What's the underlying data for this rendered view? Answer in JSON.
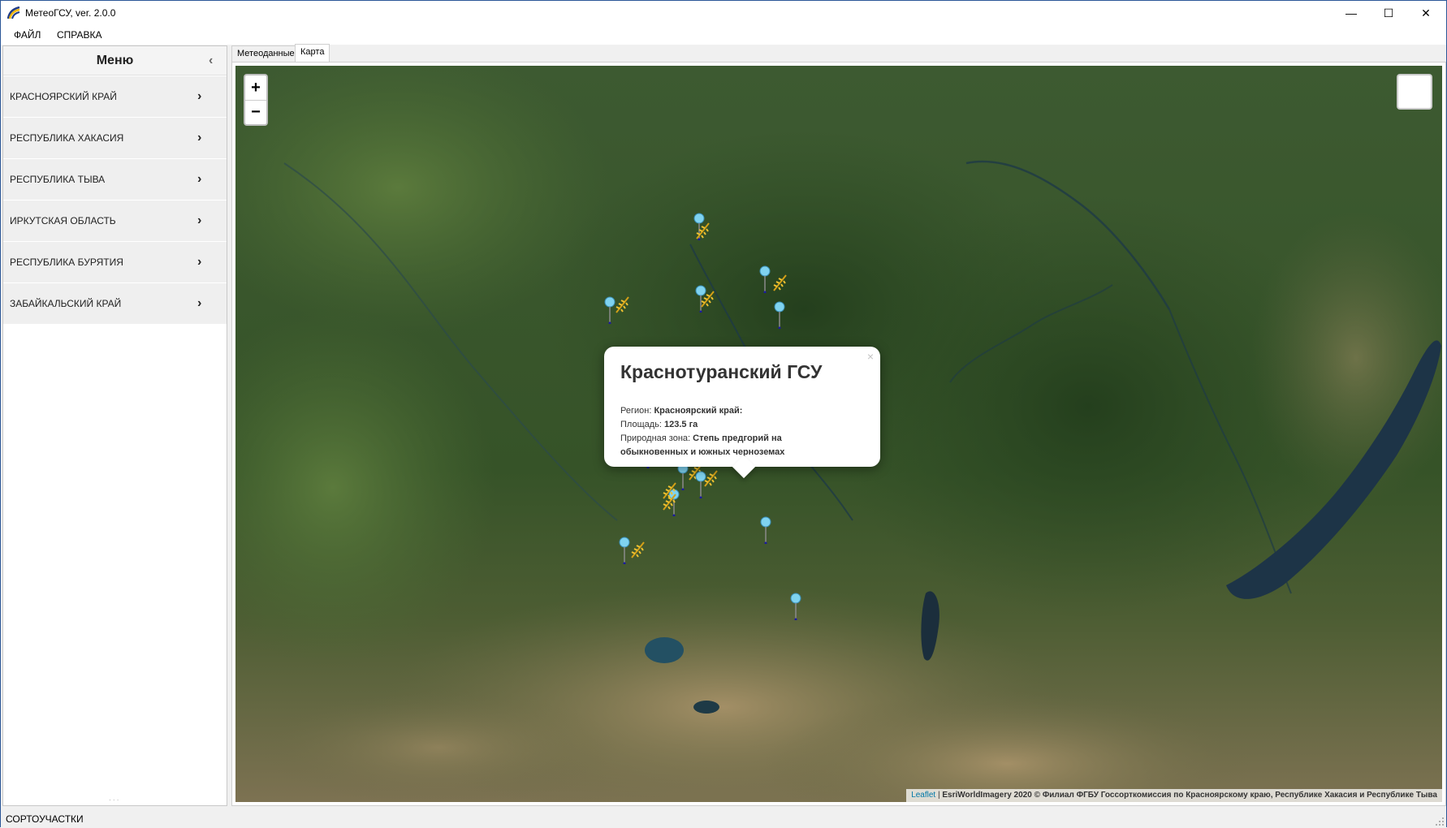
{
  "window": {
    "title": "МетеоГСУ, ver. 2.0.0",
    "controls": {
      "minimize": "—",
      "maximize": "☐",
      "close": "✕"
    }
  },
  "menubar": {
    "items": [
      "ФАЙЛ",
      "СПРАВКА"
    ]
  },
  "sidebar": {
    "title": "Меню",
    "regions": [
      "КРАСНОЯРСКИЙ КРАЙ",
      "РЕСПУБЛИКА ХАКАСИЯ",
      "РЕСПУБЛИКА ТЫВА",
      "ИРКУТСКАЯ ОБЛАСТЬ",
      "РЕСПУБЛИКА БУРЯТИЯ",
      "ЗАБАЙКАЛЬСКИЙ КРАЙ"
    ],
    "splitter": "· · ·"
  },
  "tabs": {
    "items": [
      "Метеоданные",
      "Карта"
    ],
    "active": "Карта"
  },
  "map": {
    "zoom_in": "+",
    "zoom_out": "−",
    "icons": {
      "marker": "map-pin-icon",
      "grain": "wheat-icon"
    },
    "popup": {
      "close": "×",
      "title": "Краснотуранский ГСУ",
      "region_label": "Регион: ",
      "region_value": "Красноярский край:",
      "area_label": "Площадь: ",
      "area_value": "123.5 га",
      "zone_label": "Природная зона: ",
      "zone_value_1": "Степь предгорий на",
      "zone_value_2": "обыкновенных и южных черноземах"
    },
    "attribution": {
      "leaflet": "Leaflet",
      "separator": " | ",
      "text": "EsriWorldImagery 2020 © Филиал ФГБУ Госсорткомиссия по Красноярскому краю, Республике Хакасия и Республике Тыва"
    }
  },
  "statusbar": {
    "text": "СОРТОУЧАСТКИ"
  },
  "colors": {
    "water": "#1d3447",
    "forest": "#2f4f26",
    "steppe": "#8a7a55",
    "popup_bg": "#ffffff",
    "marker_head": "#7fd3f0"
  }
}
